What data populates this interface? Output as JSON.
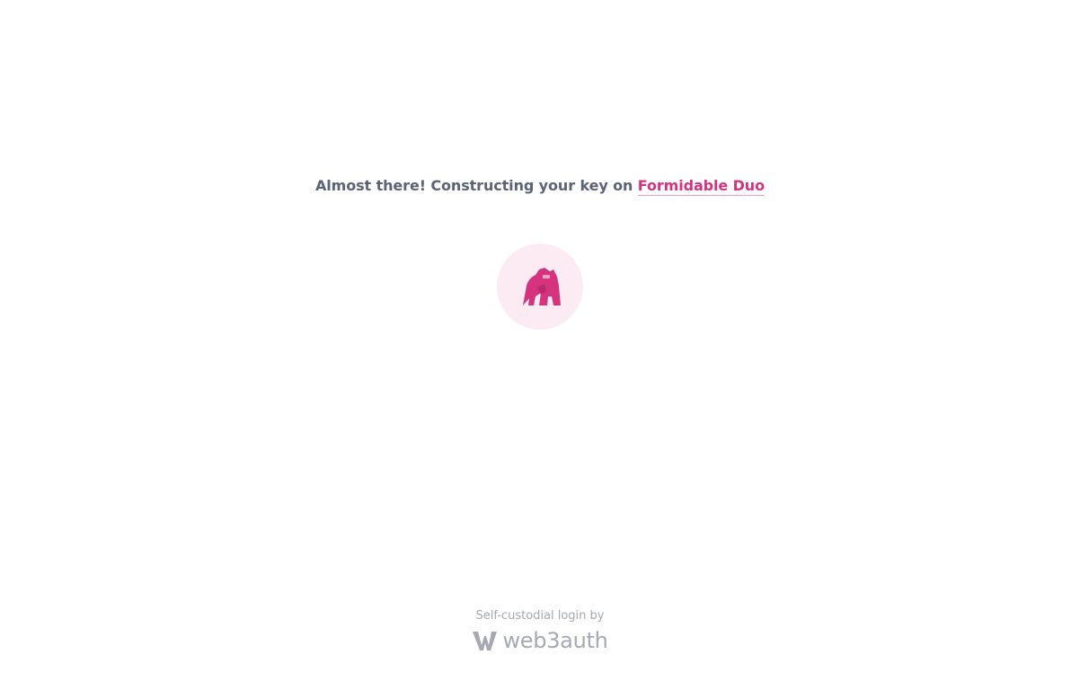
{
  "headline": {
    "prefix": "Almost there! Constructing your key on",
    "app_name": "Formidable Duo"
  },
  "app_logo": {
    "icon": "gorilla-icon",
    "color": "#d6337f",
    "background": "#fcebf3"
  },
  "footer": {
    "caption": "Self-custodial login by",
    "brand_icon": "web3auth-w-icon",
    "brand_name": "web3auth",
    "brand_color": "#a6a9b3"
  }
}
